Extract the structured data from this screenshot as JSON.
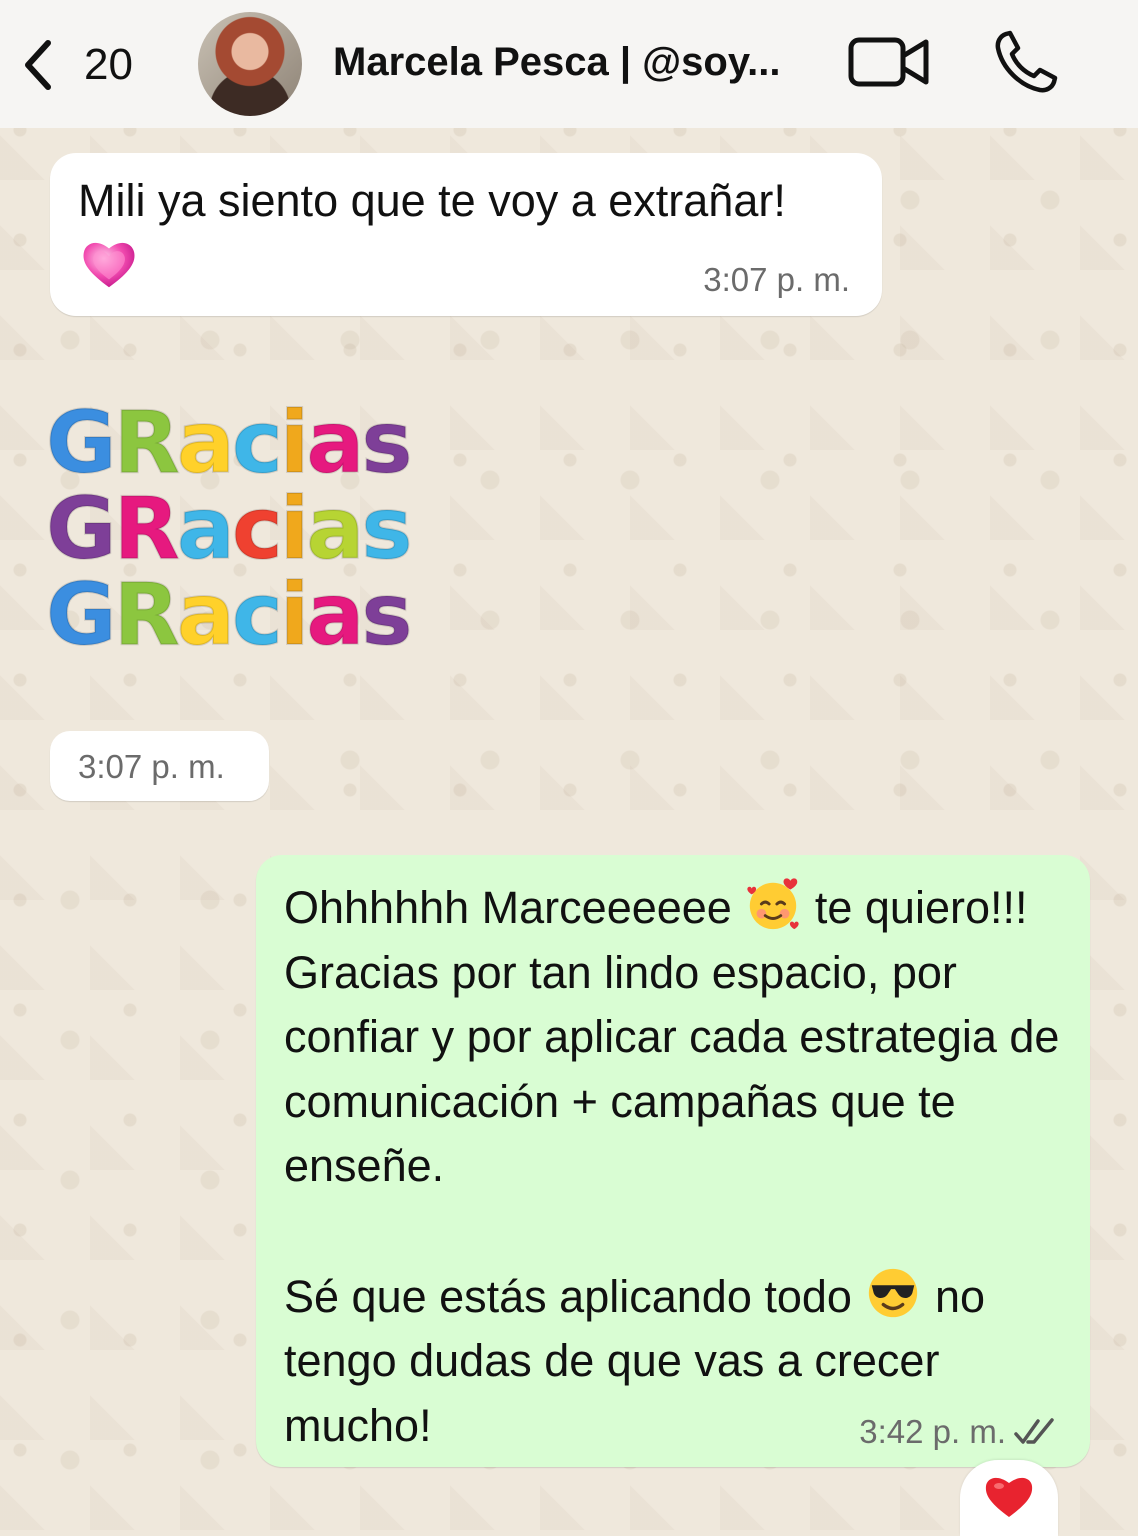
{
  "header": {
    "back_count": "20",
    "contact_name": "Marcela Pesca | @soy...",
    "avatar_icon": "contact-avatar",
    "video_icon": "video-call-icon",
    "call_icon": "phone-icon"
  },
  "messages": {
    "incoming_text": "Mili ya siento que te voy a extrañar!",
    "incoming_emoji": "pink-heart",
    "incoming_time": "3:07 p. m.",
    "sticker": {
      "lines": [
        {
          "letters": [
            "G",
            "R",
            "a",
            "c",
            "i",
            "a",
            "s"
          ],
          "colors": [
            "#3b8ee0",
            "#8cc63f",
            "#ffd12a",
            "#3fb6e8",
            "#f0a81c",
            "#e6197f",
            "#7e3f98"
          ]
        },
        {
          "letters": [
            "G",
            "R",
            "a",
            "c",
            "i",
            "a",
            "s"
          ],
          "colors": [
            "#7e3f98",
            "#e6197f",
            "#3fb6e8",
            "#ef4130",
            "#f0a81c",
            "#b7d433",
            "#3fb6e8"
          ]
        },
        {
          "letters": [
            "G",
            "R",
            "a",
            "c",
            "i",
            "a",
            "s"
          ],
          "colors": [
            "#3b8ee0",
            "#8cc63f",
            "#ffd12a",
            "#3fb6e8",
            "#f0a81c",
            "#e6197f",
            "#7e3f98"
          ]
        }
      ]
    },
    "sticker_time": "3:07 p. m.",
    "outgoing": {
      "p1a": "Ohhhhhh Marceeeeee",
      "p1b": "te quiero!!! Gracias por tan lindo espacio, por confiar y por aplicar cada estrategia de comunicación + campañas que te enseñe.",
      "p2a": "Sé que estás aplicando todo",
      "p2b": "no tengo dudas de que vas a crecer mucho!",
      "emoji1": "smiling-face-with-hearts",
      "emoji2": "smiling-face-with-sunglasses",
      "time": "3:42 p. m.",
      "status": "read"
    },
    "reaction": "red-heart"
  },
  "colors": {
    "incoming_bubble": "#ffffff",
    "outgoing_bubble": "#d9fdd3",
    "read_check": "#555555"
  }
}
